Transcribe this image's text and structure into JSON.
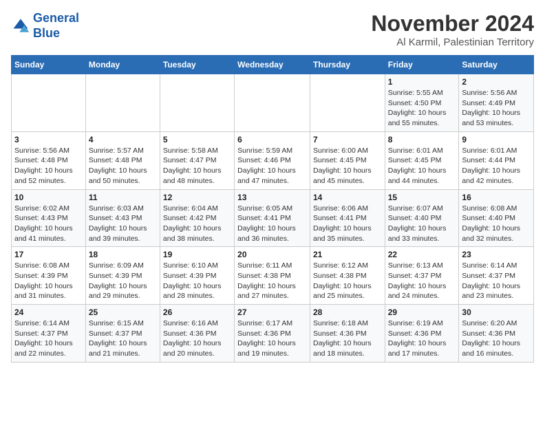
{
  "logo": {
    "line1": "General",
    "line2": "Blue"
  },
  "title": "November 2024",
  "subtitle": "Al Karmil, Palestinian Territory",
  "headers": [
    "Sunday",
    "Monday",
    "Tuesday",
    "Wednesday",
    "Thursday",
    "Friday",
    "Saturday"
  ],
  "weeks": [
    [
      {
        "day": "",
        "info": ""
      },
      {
        "day": "",
        "info": ""
      },
      {
        "day": "",
        "info": ""
      },
      {
        "day": "",
        "info": ""
      },
      {
        "day": "",
        "info": ""
      },
      {
        "day": "1",
        "info": "Sunrise: 5:55 AM\nSunset: 4:50 PM\nDaylight: 10 hours\nand 55 minutes."
      },
      {
        "day": "2",
        "info": "Sunrise: 5:56 AM\nSunset: 4:49 PM\nDaylight: 10 hours\nand 53 minutes."
      }
    ],
    [
      {
        "day": "3",
        "info": "Sunrise: 5:56 AM\nSunset: 4:48 PM\nDaylight: 10 hours\nand 52 minutes."
      },
      {
        "day": "4",
        "info": "Sunrise: 5:57 AM\nSunset: 4:48 PM\nDaylight: 10 hours\nand 50 minutes."
      },
      {
        "day": "5",
        "info": "Sunrise: 5:58 AM\nSunset: 4:47 PM\nDaylight: 10 hours\nand 48 minutes."
      },
      {
        "day": "6",
        "info": "Sunrise: 5:59 AM\nSunset: 4:46 PM\nDaylight: 10 hours\nand 47 minutes."
      },
      {
        "day": "7",
        "info": "Sunrise: 6:00 AM\nSunset: 4:45 PM\nDaylight: 10 hours\nand 45 minutes."
      },
      {
        "day": "8",
        "info": "Sunrise: 6:01 AM\nSunset: 4:45 PM\nDaylight: 10 hours\nand 44 minutes."
      },
      {
        "day": "9",
        "info": "Sunrise: 6:01 AM\nSunset: 4:44 PM\nDaylight: 10 hours\nand 42 minutes."
      }
    ],
    [
      {
        "day": "10",
        "info": "Sunrise: 6:02 AM\nSunset: 4:43 PM\nDaylight: 10 hours\nand 41 minutes."
      },
      {
        "day": "11",
        "info": "Sunrise: 6:03 AM\nSunset: 4:43 PM\nDaylight: 10 hours\nand 39 minutes."
      },
      {
        "day": "12",
        "info": "Sunrise: 6:04 AM\nSunset: 4:42 PM\nDaylight: 10 hours\nand 38 minutes."
      },
      {
        "day": "13",
        "info": "Sunrise: 6:05 AM\nSunset: 4:41 PM\nDaylight: 10 hours\nand 36 minutes."
      },
      {
        "day": "14",
        "info": "Sunrise: 6:06 AM\nSunset: 4:41 PM\nDaylight: 10 hours\nand 35 minutes."
      },
      {
        "day": "15",
        "info": "Sunrise: 6:07 AM\nSunset: 4:40 PM\nDaylight: 10 hours\nand 33 minutes."
      },
      {
        "day": "16",
        "info": "Sunrise: 6:08 AM\nSunset: 4:40 PM\nDaylight: 10 hours\nand 32 minutes."
      }
    ],
    [
      {
        "day": "17",
        "info": "Sunrise: 6:08 AM\nSunset: 4:39 PM\nDaylight: 10 hours\nand 31 minutes."
      },
      {
        "day": "18",
        "info": "Sunrise: 6:09 AM\nSunset: 4:39 PM\nDaylight: 10 hours\nand 29 minutes."
      },
      {
        "day": "19",
        "info": "Sunrise: 6:10 AM\nSunset: 4:39 PM\nDaylight: 10 hours\nand 28 minutes."
      },
      {
        "day": "20",
        "info": "Sunrise: 6:11 AM\nSunset: 4:38 PM\nDaylight: 10 hours\nand 27 minutes."
      },
      {
        "day": "21",
        "info": "Sunrise: 6:12 AM\nSunset: 4:38 PM\nDaylight: 10 hours\nand 25 minutes."
      },
      {
        "day": "22",
        "info": "Sunrise: 6:13 AM\nSunset: 4:37 PM\nDaylight: 10 hours\nand 24 minutes."
      },
      {
        "day": "23",
        "info": "Sunrise: 6:14 AM\nSunset: 4:37 PM\nDaylight: 10 hours\nand 23 minutes."
      }
    ],
    [
      {
        "day": "24",
        "info": "Sunrise: 6:14 AM\nSunset: 4:37 PM\nDaylight: 10 hours\nand 22 minutes."
      },
      {
        "day": "25",
        "info": "Sunrise: 6:15 AM\nSunset: 4:37 PM\nDaylight: 10 hours\nand 21 minutes."
      },
      {
        "day": "26",
        "info": "Sunrise: 6:16 AM\nSunset: 4:36 PM\nDaylight: 10 hours\nand 20 minutes."
      },
      {
        "day": "27",
        "info": "Sunrise: 6:17 AM\nSunset: 4:36 PM\nDaylight: 10 hours\nand 19 minutes."
      },
      {
        "day": "28",
        "info": "Sunrise: 6:18 AM\nSunset: 4:36 PM\nDaylight: 10 hours\nand 18 minutes."
      },
      {
        "day": "29",
        "info": "Sunrise: 6:19 AM\nSunset: 4:36 PM\nDaylight: 10 hours\nand 17 minutes."
      },
      {
        "day": "30",
        "info": "Sunrise: 6:20 AM\nSunset: 4:36 PM\nDaylight: 10 hours\nand 16 minutes."
      }
    ]
  ]
}
